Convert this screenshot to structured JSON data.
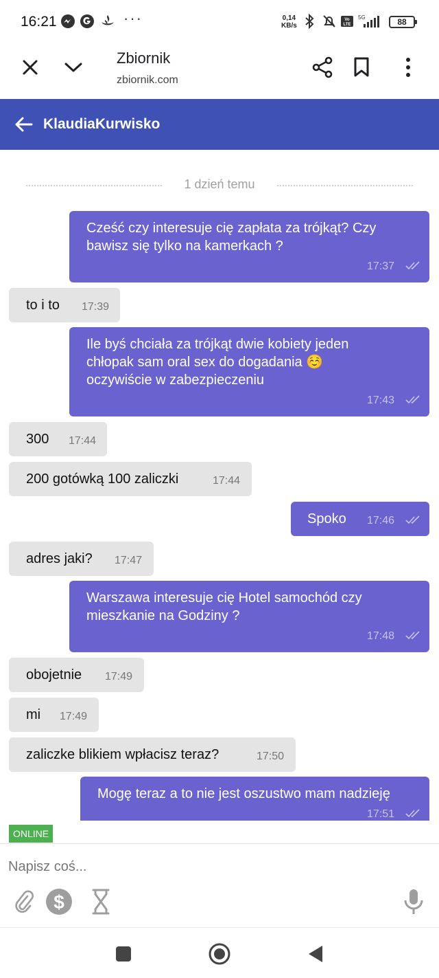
{
  "status_bar": {
    "time": "16:21",
    "net_speed_value": "0,14",
    "net_speed_unit": "KB/s",
    "network": "5G",
    "battery": "88",
    "icons": [
      "messenger-icon",
      "google-icon",
      "santander-icon",
      "more-dots-icon",
      "bluetooth-icon",
      "mute-icon",
      "volte-icon",
      "signal-icon",
      "battery-icon"
    ]
  },
  "toolbar": {
    "title": "Zbiornik",
    "url": "zbiornik.com",
    "icons": [
      "close-icon",
      "chevron-down-icon",
      "share-icon",
      "bookmark-icon",
      "more-vert-icon"
    ]
  },
  "header": {
    "title": "KlaudiaKurwisko"
  },
  "chat": {
    "date_divider": "1 dzień temu",
    "messages": [
      {
        "dir": "out",
        "lines": [
          "Cześć czy interesuje cię zapłata za trójkąt? Czy",
          "bawisz się tylko na kamerkach ?"
        ],
        "time": "17:37"
      },
      {
        "dir": "in",
        "lines": [
          "to i to"
        ],
        "time": "17:39"
      },
      {
        "dir": "out",
        "lines": [
          "Ile byś chciała za trójkąt dwie kobiety jeden",
          "chłopak sam oral sex do dogadania ☺️",
          "oczywiście w zabezpieczeniu"
        ],
        "time": "17:43"
      },
      {
        "dir": "in",
        "lines": [
          "300"
        ],
        "time": "17:44"
      },
      {
        "dir": "in",
        "lines": [
          "200 gotówką 100 zaliczki"
        ],
        "time": "17:44"
      },
      {
        "dir": "out",
        "lines": [
          "Spoko"
        ],
        "time": "17:46"
      },
      {
        "dir": "in",
        "lines": [
          "adres jaki?"
        ],
        "time": "17:47"
      },
      {
        "dir": "out",
        "lines": [
          "Warszawa interesuje cię Hotel samochód czy",
          "mieszkanie na Godziny ?"
        ],
        "time": "17:48"
      },
      {
        "dir": "in",
        "lines": [
          "obojetnie"
        ],
        "time": "17:49"
      },
      {
        "dir": "in",
        "lines": [
          "mi"
        ],
        "time": "17:49"
      },
      {
        "dir": "in",
        "lines": [
          "zaliczke blikiem wpłacisz teraz?"
        ],
        "time": "17:50"
      },
      {
        "dir": "out",
        "lines": [
          "Mogę teraz a to nie jest oszustwo mam nadzieję"
        ],
        "time": "17:51"
      }
    ]
  },
  "composer": {
    "status_badge": "ONLINE",
    "placeholder": "Napisz coś...",
    "icons": [
      "attachment-icon",
      "dollar-coin-icon",
      "hourglass-icon",
      "microphone-icon"
    ]
  },
  "colors": {
    "header_bg": "#3f51b5",
    "outgoing_bubble": "#6a63cf",
    "incoming_bubble": "#e4e4e4",
    "online_badge": "#4caf50"
  },
  "navigation_bar": {
    "icons": [
      "recents-square-icon",
      "home-circle-icon",
      "back-triangle-icon"
    ]
  }
}
